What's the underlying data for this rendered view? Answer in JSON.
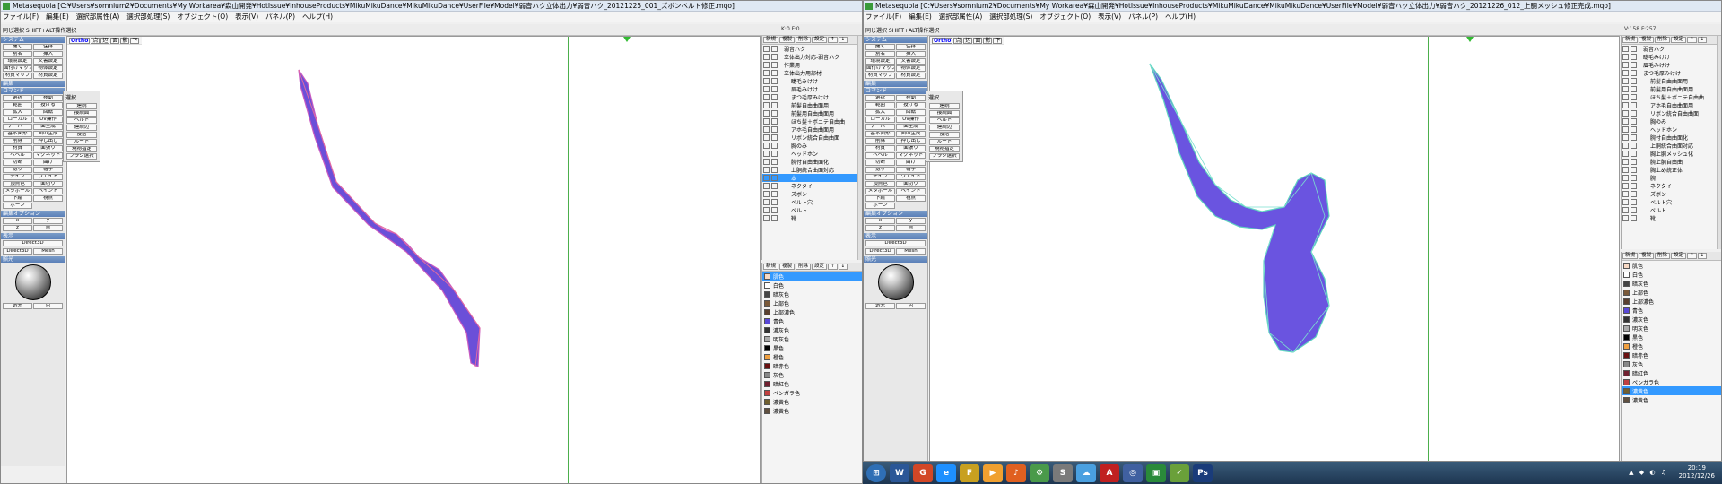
{
  "left": {
    "title": "Metasequoia [C:¥Users¥somnium2¥Documents¥My Workarea¥森山開発¥HotIssue¥InhouseProducts¥MikuMikuDance¥MikuMikuDance¥UserFile¥Model¥弱音ハク立体出力¥弱音ハク_20121225_001_ズボンベルト修正.mqo]",
    "status": "K:0   F:0",
    "viewlabel": "Ortho",
    "objects": [
      "弱音ハク",
      "立体出力対応-弱音ハク",
      "作業用",
      "立体出力用部材",
      "睫毛みけけ",
      "眉毛みけけ",
      "まつ毛厚みけけ",
      "前髪自由曲面用",
      "前髪用自由曲面用",
      "ほち髪＋ボニテ自由曲",
      "アホ毛自由曲面用",
      "リボン統合自由曲面",
      "胸のみ",
      "ヘッドホン",
      "腕付自由曲面化",
      "上胴統合曲面対応",
      "本",
      "ネクタイ",
      "ズボン",
      "ベルト穴",
      "ベルト",
      "靴"
    ],
    "selected_object": "本",
    "materials": [
      "肌色",
      "白色",
      "暗灰色",
      "上部色",
      "上部濃色",
      "青色",
      "濃灰色",
      "明灰色",
      "黒色",
      "橙色",
      "暗赤色",
      "灰色",
      "暗紅色",
      "ペンガラ色",
      "濃黄色",
      "濃黄色"
    ],
    "selected_material": "肌色"
  },
  "right": {
    "title": "Metasequoia [C:¥Users¥somnium2¥Documents¥My Workarea¥森山開発¥HotIssue¥InhouseProducts¥MikuMikuDance¥MikuMikuDance¥UserFile¥Model¥弱音ハク立体出力¥弱音ハク_20121226_012_上胴メッシュ修正完成.mqo]",
    "status": "V:158   F:257",
    "viewlabel": "Ortho",
    "objects": [
      "弱音ハク",
      "睫毛みけけ",
      "眉毛みけけ",
      "まつ毛厚みけけ",
      "前髪自由曲面用",
      "前髪用自由曲面用",
      "ほち髪＋ボニテ自由曲",
      "アホ毛自由曲面用",
      "リボン統合自由曲面",
      "胸のみ",
      "ヘッドホン",
      "腕付自由曲面化",
      "上胴統合曲面対応",
      "胸上胴メッシュ化",
      "腕上胴自由曲",
      "胸上め統正体",
      "腕",
      "ネクタイ",
      "ズボン",
      "ベルト穴",
      "ベルト",
      "靴"
    ],
    "materials": [
      "肌色",
      "白色",
      "暗灰色",
      "上部色",
      "上部濃色",
      "青色",
      "濃灰色",
      "明灰色",
      "黒色",
      "橙色",
      "暗赤色",
      "灰色",
      "暗紅色",
      "ペンガラ色",
      "濃黄色",
      "濃黄色"
    ],
    "selected_material": "濃黄色"
  },
  "menu": [
    "ファイル(F)",
    "編集(E)",
    "選択部属性(A)",
    "選択部処理(S)",
    "オブジェクト(O)",
    "表示(V)",
    "パネル(P)",
    "ヘルプ(H)"
  ],
  "toolbar_label": "同じ選択  SHIFT+ALT操作選択",
  "panel": {
    "system": "システム",
    "edit": "編集",
    "command": "コマンド",
    "editopt": "編集オプション",
    "display": "表示",
    "light": "照光",
    "sys_buttons": [
      "開く",
      "保存",
      "別名",
      "挿入",
      "環境設定",
      "文書設定",
      "面付けマップ",
      "物体設定",
      "材質マップ",
      "材質設定"
    ],
    "cmd_buttons": [
      "選択",
      "移動",
      "範囲",
      "投げる",
      "拡大",
      "回転",
      "ローカル",
      "UV操作",
      "テーパー",
      "面生成",
      "基本図形",
      "面の生成",
      "削除",
      "押し出し",
      "材質",
      "面張り",
      "ベベル",
      "マグネット",
      "切断",
      "曲げ",
      "捻り",
      "帽子",
      "ナイフ",
      "ウエイト",
      "頂点色",
      "面切り",
      "メタボール",
      "ペイント",
      "下絵",
      "視点",
      "ボーン"
    ],
    "direct3d": "Direct3D",
    "mesh": "Mesh",
    "light_labels": [
      "透光",
      "色"
    ]
  },
  "selpop": {
    "title": "選択",
    "items": [
      "連続",
      "接続面",
      "ベルト",
      "連続辺",
      "投落",
      "ルート",
      "現物指定",
      "ブラシ選択"
    ]
  },
  "tabs": [
    "新規",
    "複製",
    "削除",
    "設定",
    "↑",
    "↓"
  ],
  "taskbar": {
    "time": "20:19",
    "date": "2012/12/26",
    "apps": [
      "W",
      "G",
      "e",
      "F",
      "▶",
      "♪",
      "⚙",
      "S",
      "☁",
      "A",
      "◎",
      "▣",
      "✓",
      "Ps"
    ]
  }
}
